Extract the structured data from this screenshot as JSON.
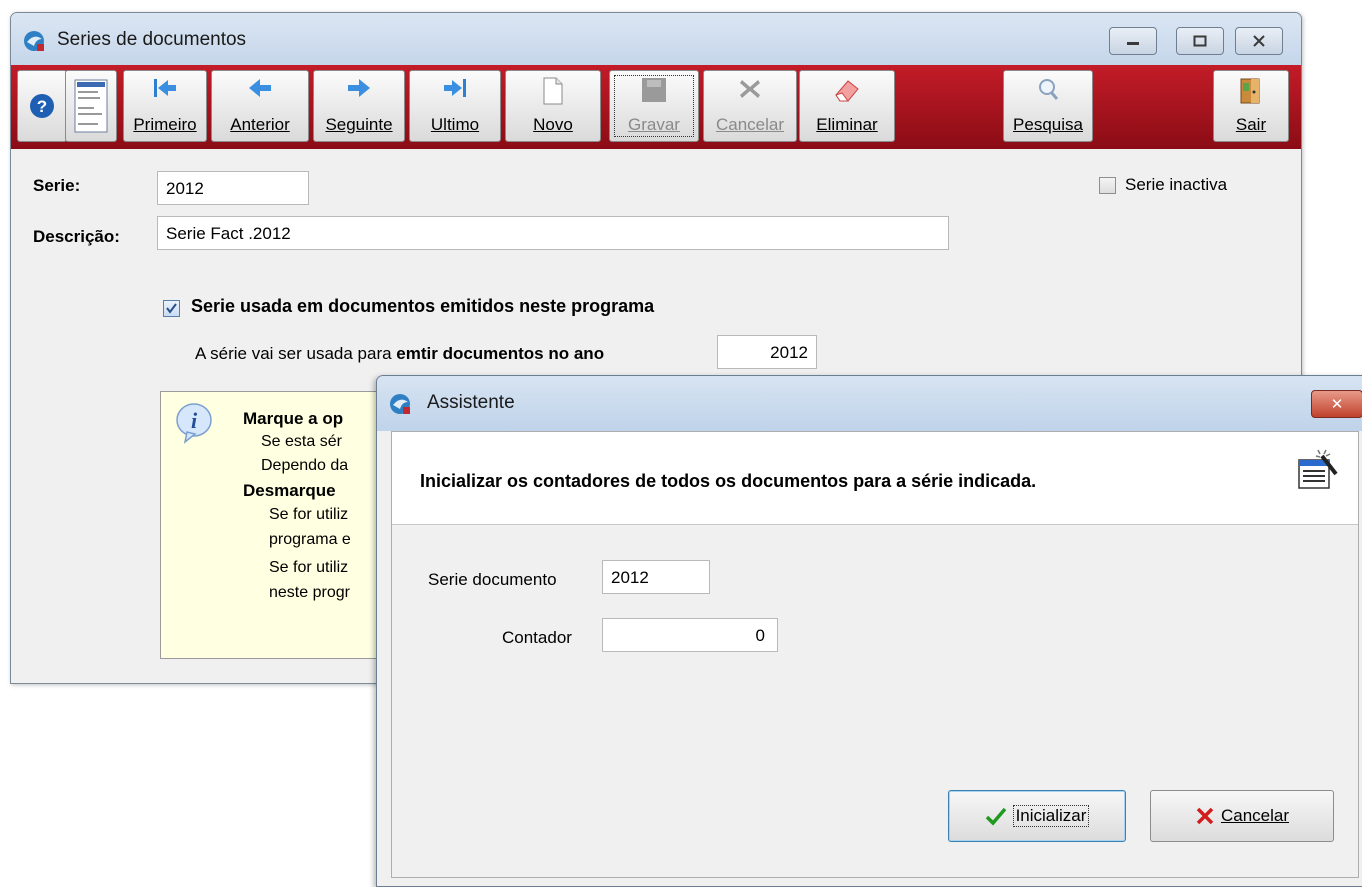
{
  "main_window": {
    "title": "Series de documentos",
    "toolbar": {
      "primeiro": "Primeiro",
      "anterior": "Anterior",
      "seguinte": "Seguinte",
      "ultimo": "Ultimo",
      "novo": "Novo",
      "gravar": "Gravar",
      "cancelar": "Cancelar",
      "eliminar": "Eliminar",
      "pesquisa": "Pesquisa",
      "sair": "Sair"
    },
    "form": {
      "serie_label": "Serie:",
      "serie_value": "2012",
      "descricao_label": "Descrição:",
      "descricao_value": "Serie Fact .2012",
      "inactiva_label": "Serie inactiva",
      "usada_label": "Serie usada em documentos emitidos neste programa",
      "ano_prefix": "A série vai ser usada para ",
      "ano_bold": "emtir documentos no ano",
      "ano_value": "2012"
    },
    "info": {
      "line1": "Marque a op",
      "line2": "Se esta sér",
      "line3": "Dependo da",
      "line4": "Desmarque",
      "line5": "Se for utiliz",
      "line6": "programa e",
      "line7": "Se for utiliz",
      "line8": "neste progr"
    }
  },
  "dialog": {
    "title": "Assistente",
    "close_symbol": "✕",
    "header_text": "Inicializar os contadores de todos os documentos para a série indicada.",
    "serie_label": "Serie documento",
    "serie_value": "2012",
    "contador_label": "Contador",
    "contador_value": "0",
    "inicializar_label": "Inicializar",
    "cancelar_label": "Cancelar"
  }
}
